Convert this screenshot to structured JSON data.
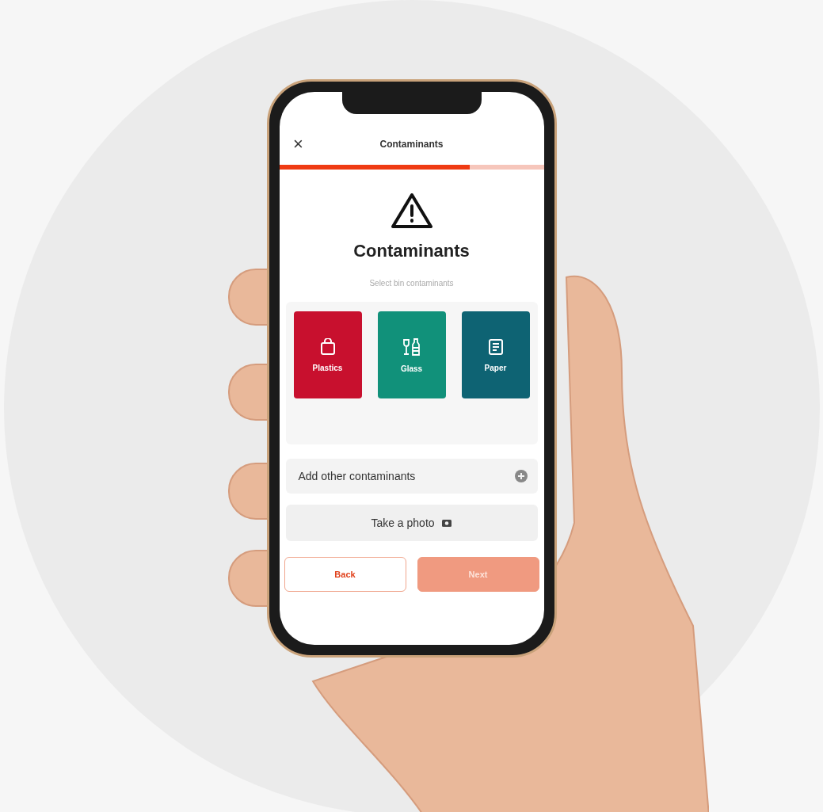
{
  "header": {
    "close": "×",
    "title": "Contaminants"
  },
  "progress": {
    "level": 0.72
  },
  "heading": "Contaminants",
  "subtitle": "Select bin contaminants",
  "categories": [
    {
      "kind": "bag",
      "label": "Plastics",
      "color": "#c8102e"
    },
    {
      "kind": "bottle",
      "label": "Glass",
      "color": "#11917a"
    },
    {
      "kind": "document",
      "label": "Paper",
      "color": "#0e6373"
    }
  ],
  "add_other": {
    "label": "Add other contaminants"
  },
  "photo_button": {
    "label": "Take a photo"
  },
  "buttons": [
    {
      "kind": "secondary",
      "label": "Back",
      "disabled": false
    },
    {
      "kind": "primary",
      "label": "Next",
      "disabled": true
    }
  ]
}
